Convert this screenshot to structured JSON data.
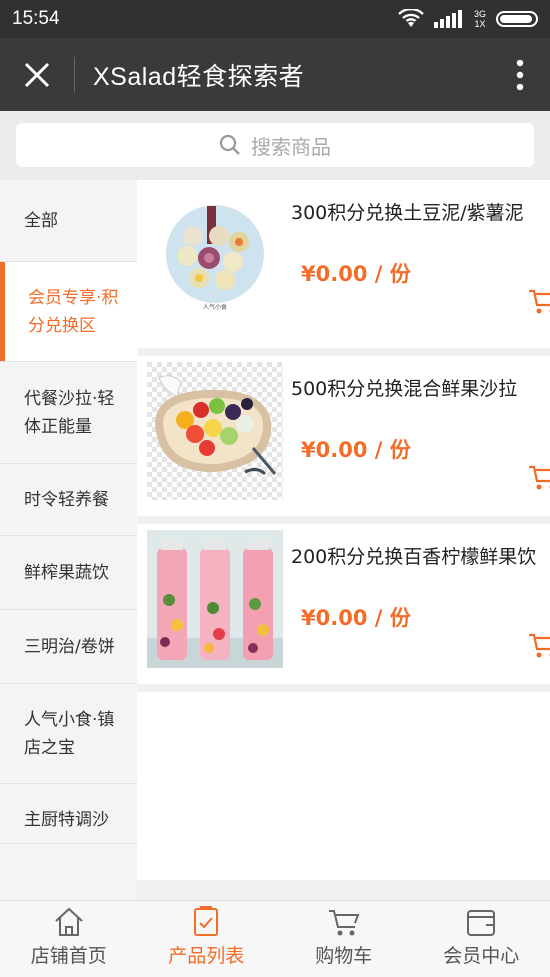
{
  "status_bar": {
    "time": "15:54",
    "network_top": "3G",
    "network_bottom": "1X",
    "battery_level": 0.95
  },
  "app_bar": {
    "title": "XSalad轻食探索者",
    "close_icon": "close-icon",
    "more_icon": "more-vertical-icon"
  },
  "search": {
    "placeholder": "搜索商品",
    "icon": "search-icon"
  },
  "categories": [
    {
      "label": "全部"
    },
    {
      "label": "会员专享·积分兑换区",
      "active": true
    },
    {
      "label": "代餐沙拉·轻体正能量"
    },
    {
      "label": "时令轻养餐"
    },
    {
      "label": "鲜榨果蔬饮"
    },
    {
      "label": "三明治/卷饼"
    },
    {
      "label": "人气小食·镇店之宝"
    },
    {
      "label": "主厨特调沙"
    }
  ],
  "products": [
    {
      "name": "300积分兑换土豆泥/紫薯泥",
      "price": "¥0.00 / 份",
      "image_caption": "人气小食"
    },
    {
      "name": "500积分兑换混合鲜果沙拉",
      "price": "¥0.00 / 份"
    },
    {
      "name": "200积分兑换百香柠檬鲜果饮",
      "price": "¥0.00 / 份"
    }
  ],
  "bottom_nav": [
    {
      "label": "店铺首页",
      "icon": "home-icon"
    },
    {
      "label": "产品列表",
      "icon": "product-list-icon",
      "active": true
    },
    {
      "label": "购物车",
      "icon": "cart-icon"
    },
    {
      "label": "会员中心",
      "icon": "wallet-icon"
    }
  ],
  "colors": {
    "accent": "#f26c2a",
    "status_bar": "#2f3133",
    "app_bar": "#393a3c"
  }
}
